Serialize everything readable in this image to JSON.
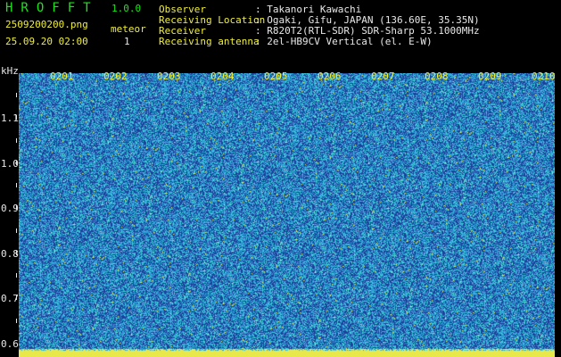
{
  "header": {
    "title": "HROFFT",
    "version": "1.0.0",
    "filename": "2509200200.png",
    "datetime": "25.09.20 02:00",
    "meteor_label": "meteor",
    "meteor_count": "1"
  },
  "info": [
    {
      "key": "Observer",
      "value": ": Takanori Kawachi"
    },
    {
      "key": "Receiving Location",
      "value": ": Ogaki, Gifu, JAPAN (136.60E, 35.35N)"
    },
    {
      "key": "Receiver",
      "value": ": R820T2(RTL-SDR) SDR-Sharp 53.1000MHz"
    },
    {
      "key": "Receiving antenna",
      "value": ": 2el-HB9CV Vertical (el. E-W)"
    }
  ],
  "axis": {
    "unit": "kHz",
    "y_ticks": [
      "1.1",
      "1.0",
      "0.9",
      "0.8",
      "0.7",
      "0.6"
    ],
    "y_values": [
      1.1,
      1.0,
      0.9,
      0.8,
      0.7,
      0.6
    ],
    "y_range": [
      0.57,
      1.2
    ],
    "x_ticks": [
      "0201",
      "0202",
      "0203",
      "0204",
      "0205",
      "0206",
      "0207",
      "0208",
      "0209",
      "0210"
    ]
  },
  "colors": {
    "background": "#000000",
    "noise_dark": "#1f3f9a",
    "noise_mid": "#2c9ad6",
    "noise_light": "#3fd2d8",
    "signal": "#e9e84a",
    "label_green": "#19e619",
    "label_yellow": "#f0ef3a"
  }
}
